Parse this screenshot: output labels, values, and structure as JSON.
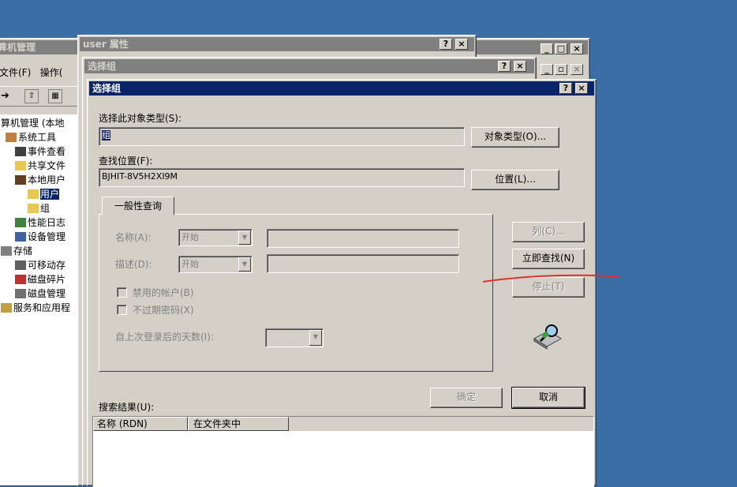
{
  "comp_mgmt": {
    "title": "算机管理",
    "menu": [
      "文件(F)",
      "操作("
    ],
    "tree": [
      "算机管理 (本地",
      "系统工具",
      "事件查看",
      "共享文件",
      "本地用户",
      "用户",
      "组",
      "性能日志",
      "设备管理",
      "存储",
      "可移动存",
      "磁盘碎片",
      "磁盘管理",
      "服务和应用程"
    ],
    "win_buttons": [
      "_",
      "□",
      "×"
    ]
  },
  "user_props": {
    "title": "user 属性",
    "buttons": [
      "?",
      "×"
    ]
  },
  "select_group_back": {
    "title": "选择组",
    "buttons": [
      "?",
      "×"
    ]
  },
  "dialog": {
    "title": "选择组",
    "buttons": [
      "?",
      "×"
    ],
    "object_type_label": "选择此对象类型(S):",
    "object_type_value": "组",
    "object_type_button": "对象类型(O)...",
    "location_label": "查找位置(F):",
    "location_value": "BJHIT-8V5H2XI9M",
    "location_button": "位置(L)...",
    "tab_label": "一般性查询",
    "name_label": "名称(A):",
    "name_mode": "开始",
    "desc_label": "描述(D):",
    "desc_mode": "开始",
    "disabled_accounts": "禁用的帐户(B)",
    "nonexpiring_pw": "不过期密码(X)",
    "days_since_logon": "自上次登录后的天数(I):",
    "columns_button": "列(C)...",
    "find_now_button": "立即查找(N)",
    "stop_button": "停止(T)",
    "ok_button": "确定",
    "cancel_button": "取消",
    "results_label": "搜索结果(U):",
    "results_columns": [
      "名称 (RDN)",
      "在文件夹中"
    ]
  },
  "colors": {
    "desktop": "#3a6ea5",
    "active_title": "#0a246a",
    "annotation_line": "#e03030"
  }
}
